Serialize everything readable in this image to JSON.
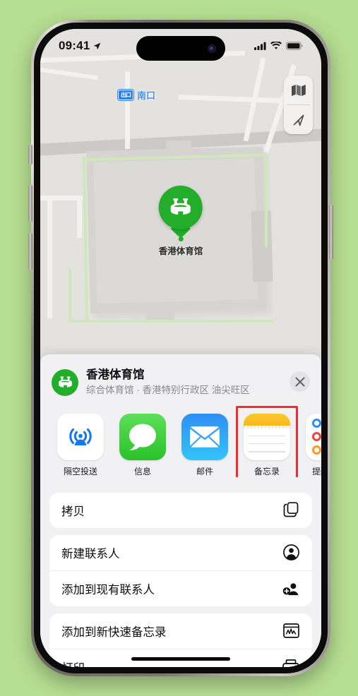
{
  "background_color": "#b6de92",
  "status_bar": {
    "time": "09:41",
    "location_arrow_icon": "location-arrow-icon",
    "cellular_icon": "cellular-bars-icon",
    "wifi_icon": "wifi-icon",
    "battery_icon": "battery-full-icon"
  },
  "map": {
    "transit_badge": "出口",
    "transit_label": "南口",
    "pin_label": "香港体育馆",
    "pin_icon": "stadium-icon",
    "pin_color": "#22ae2a",
    "controls": [
      {
        "name": "map-type-button",
        "icon": "folded-map-icon"
      },
      {
        "name": "locate-me-button",
        "icon": "navigation-arrow-icon"
      }
    ]
  },
  "share_sheet": {
    "avatar_icon": "stadium-icon",
    "title": "香港体育馆",
    "subtitle": "综合体育馆 · 香港特别行政区 油尖旺区",
    "close_icon": "close-icon",
    "apps": [
      {
        "label": "隔空投送",
        "icon": "airdrop-icon",
        "highlighted": false
      },
      {
        "label": "信息",
        "icon": "messages-icon",
        "highlighted": false
      },
      {
        "label": "邮件",
        "icon": "mail-icon",
        "highlighted": false
      },
      {
        "label": "备忘录",
        "icon": "notes-icon",
        "highlighted": true
      },
      {
        "label": "提醒事项",
        "icon": "reminders-icon",
        "highlighted": false
      }
    ],
    "highlight_color": "#f22c2c",
    "actions": [
      {
        "label": "拷贝",
        "icon": "doc-on-doc-icon"
      },
      {
        "label": "新建联系人",
        "icon": "person-circle-icon"
      },
      {
        "label": "添加到现有联系人",
        "icon": "person-badge-plus-icon"
      },
      {
        "label": "添加到新快速备忘录",
        "icon": "quick-note-icon"
      },
      {
        "label": "打印",
        "icon": "printer-icon"
      }
    ]
  }
}
